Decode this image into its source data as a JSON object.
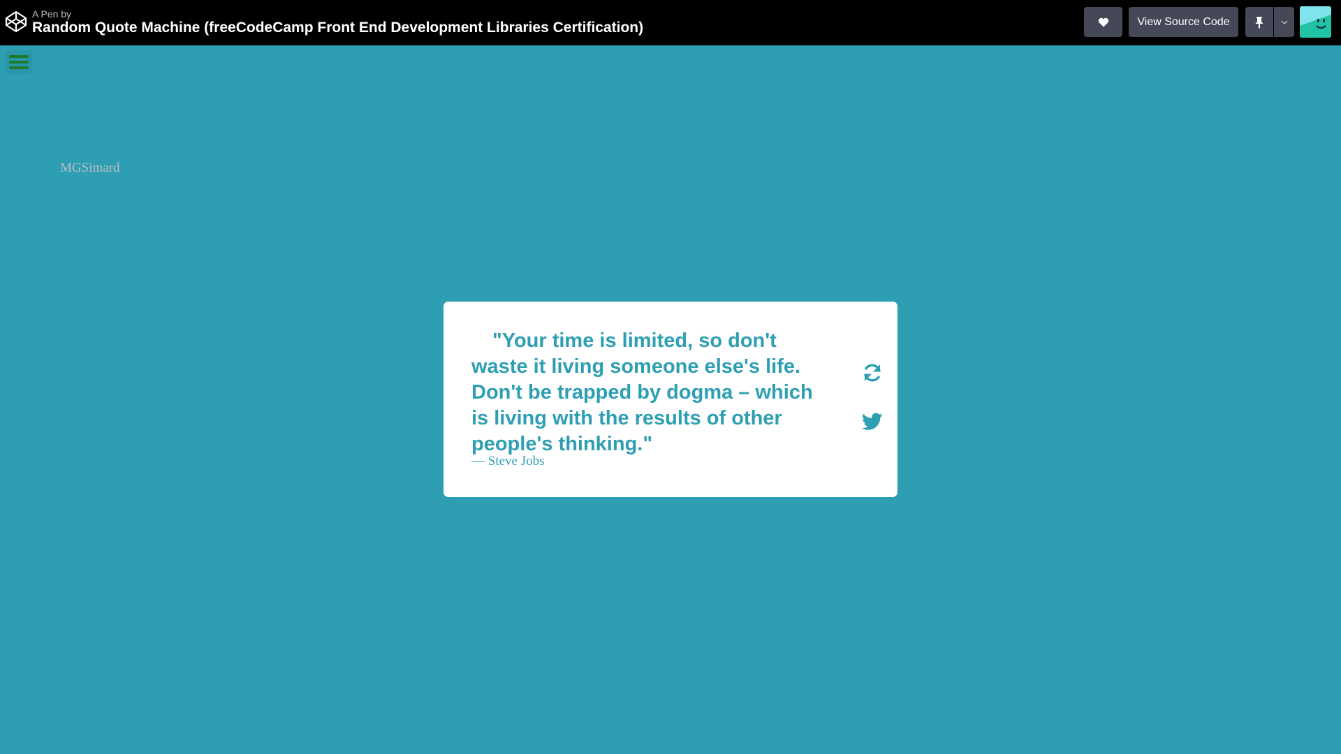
{
  "header": {
    "pen_by_prefix": "A Pen by",
    "author": "MGSimard",
    "title": "Random Quote Machine (freeCodeCamp Front End Development Libraries Certification)",
    "source_button": "View Source Code"
  },
  "quote": {
    "text": "\"Your time is limited, so don't waste it living someone else's life. Don't be trapped by dogma – which is living with the results of other people's thinking.\"",
    "author": "— Steve Jobs"
  },
  "colors": {
    "accent": "#2e9fb3",
    "topbar": "#000000",
    "button_bg": "#444857",
    "menu_icon": "#1f7a2e"
  }
}
